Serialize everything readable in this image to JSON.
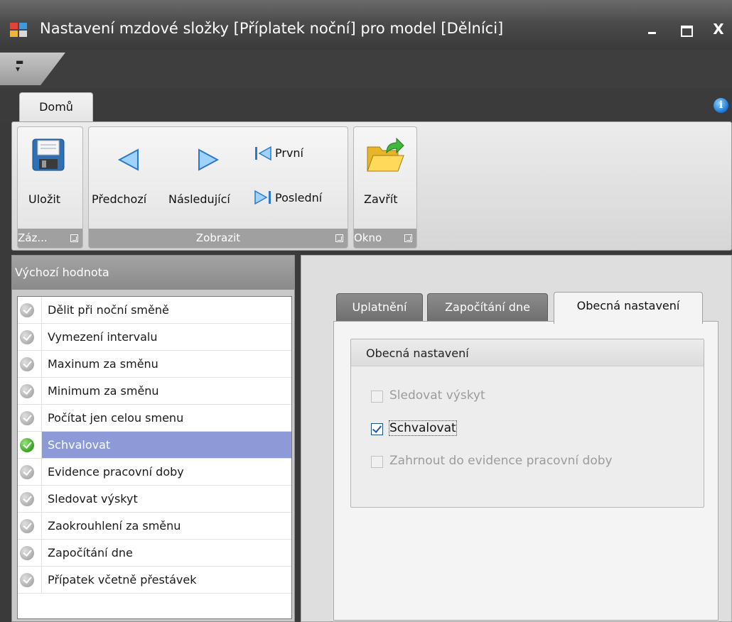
{
  "window": {
    "title": "Nastavení mzdové složky [Příplatek noční] pro model [Dělníci]",
    "close_glyph": "X"
  },
  "ribbon": {
    "tab_label": "Domů",
    "groups": {
      "save": {
        "footer": "Záz...",
        "button": "Uložit"
      },
      "view": {
        "footer": "Zobrazit",
        "previous": "Předchozí",
        "next": "Následující",
        "first": "První",
        "last": "Poslední"
      },
      "window": {
        "footer": "Okno",
        "close": "Zavřít"
      }
    }
  },
  "left_panel": {
    "header": "Výchozí hodnota",
    "items": [
      {
        "label": "Dělit při noční směně",
        "selected": false
      },
      {
        "label": "Vymezení intervalu",
        "selected": false
      },
      {
        "label": "Maxinum za směnu",
        "selected": false
      },
      {
        "label": "Minimum za směnu",
        "selected": false
      },
      {
        "label": "Počítat jen celou smenu",
        "selected": false
      },
      {
        "label": "Schvalovat",
        "selected": true
      },
      {
        "label": "Evidence pracovní doby",
        "selected": false
      },
      {
        "label": "Sledovat výskyt",
        "selected": false
      },
      {
        "label": "Zaokrouhlení za směnu",
        "selected": false
      },
      {
        "label": "Započítání dne",
        "selected": false
      },
      {
        "label": "Přípatek včetně přestávek",
        "selected": false
      }
    ]
  },
  "right_panel": {
    "tabs": [
      {
        "label": "Uplatnění",
        "active": false
      },
      {
        "label": "Započítání dne",
        "active": false
      },
      {
        "label": "Obecná nastavení",
        "active": true
      }
    ],
    "group_title": "Obecná nastavení",
    "options": [
      {
        "label": "Sledovat výskyt",
        "checked": false,
        "enabled": false
      },
      {
        "label": "Schvalovat",
        "checked": true,
        "enabled": true
      },
      {
        "label": "Zahrnout do evidence pracovní doby",
        "checked": false,
        "enabled": false
      }
    ]
  },
  "colors": {
    "selection": "#8e9ad8",
    "dark_chrome": "#3a3a3a",
    "group_footer": "#a0a0a0"
  }
}
